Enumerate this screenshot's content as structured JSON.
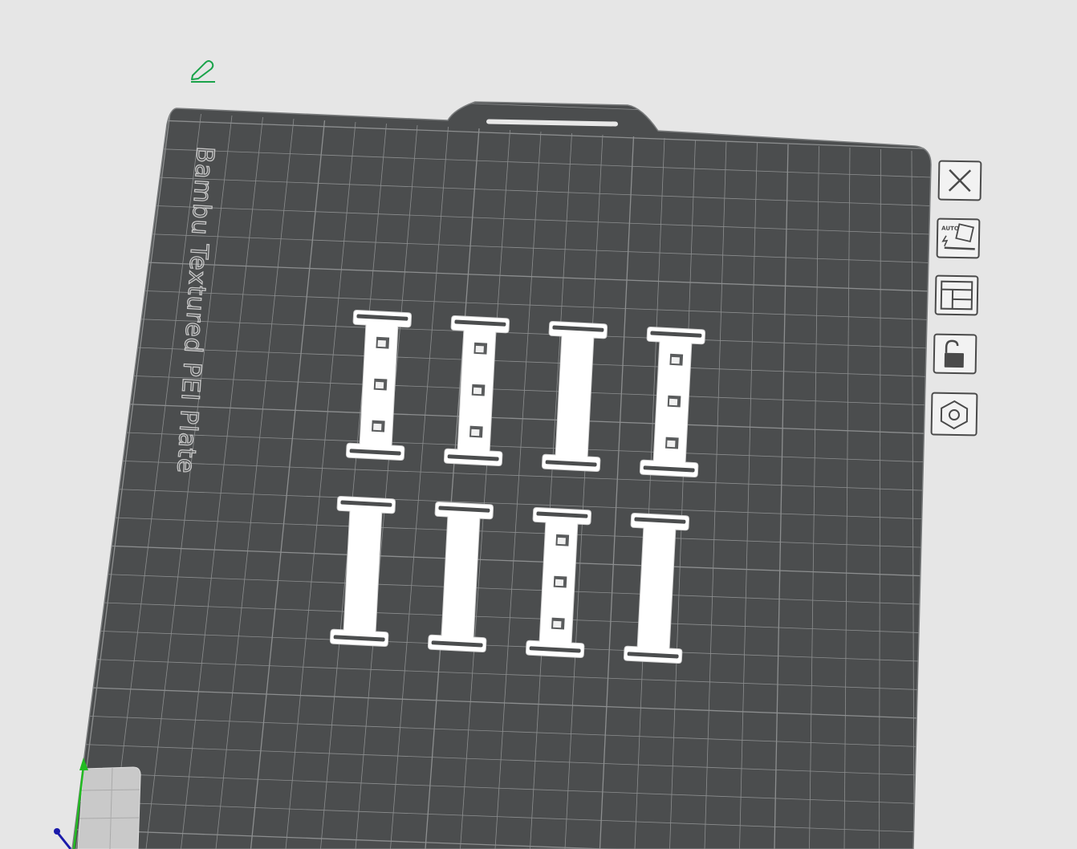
{
  "plate": {
    "name": "Bambu Textured PEI Plate"
  },
  "toolbar": {
    "items": [
      {
        "name": "close",
        "icon": "close-icon"
      },
      {
        "name": "auto-orient",
        "icon": "auto-orient-icon",
        "label": "AUTO"
      },
      {
        "name": "arrange",
        "icon": "arrange-icon"
      },
      {
        "name": "lock",
        "icon": "unlock-icon"
      },
      {
        "name": "plate-settings",
        "icon": "hexagon-settings-icon"
      }
    ]
  },
  "scene": {
    "part_rows": 2,
    "part_columns": 4
  },
  "colors": {
    "background": "#e6e6e6",
    "plate": "#4b4d4e",
    "grid": "#8c8e8f",
    "parts": "#ffffff",
    "edit_icon": "#1aa34a",
    "axis_y": "#22bb22",
    "axis_z": "#1a1aaa"
  }
}
